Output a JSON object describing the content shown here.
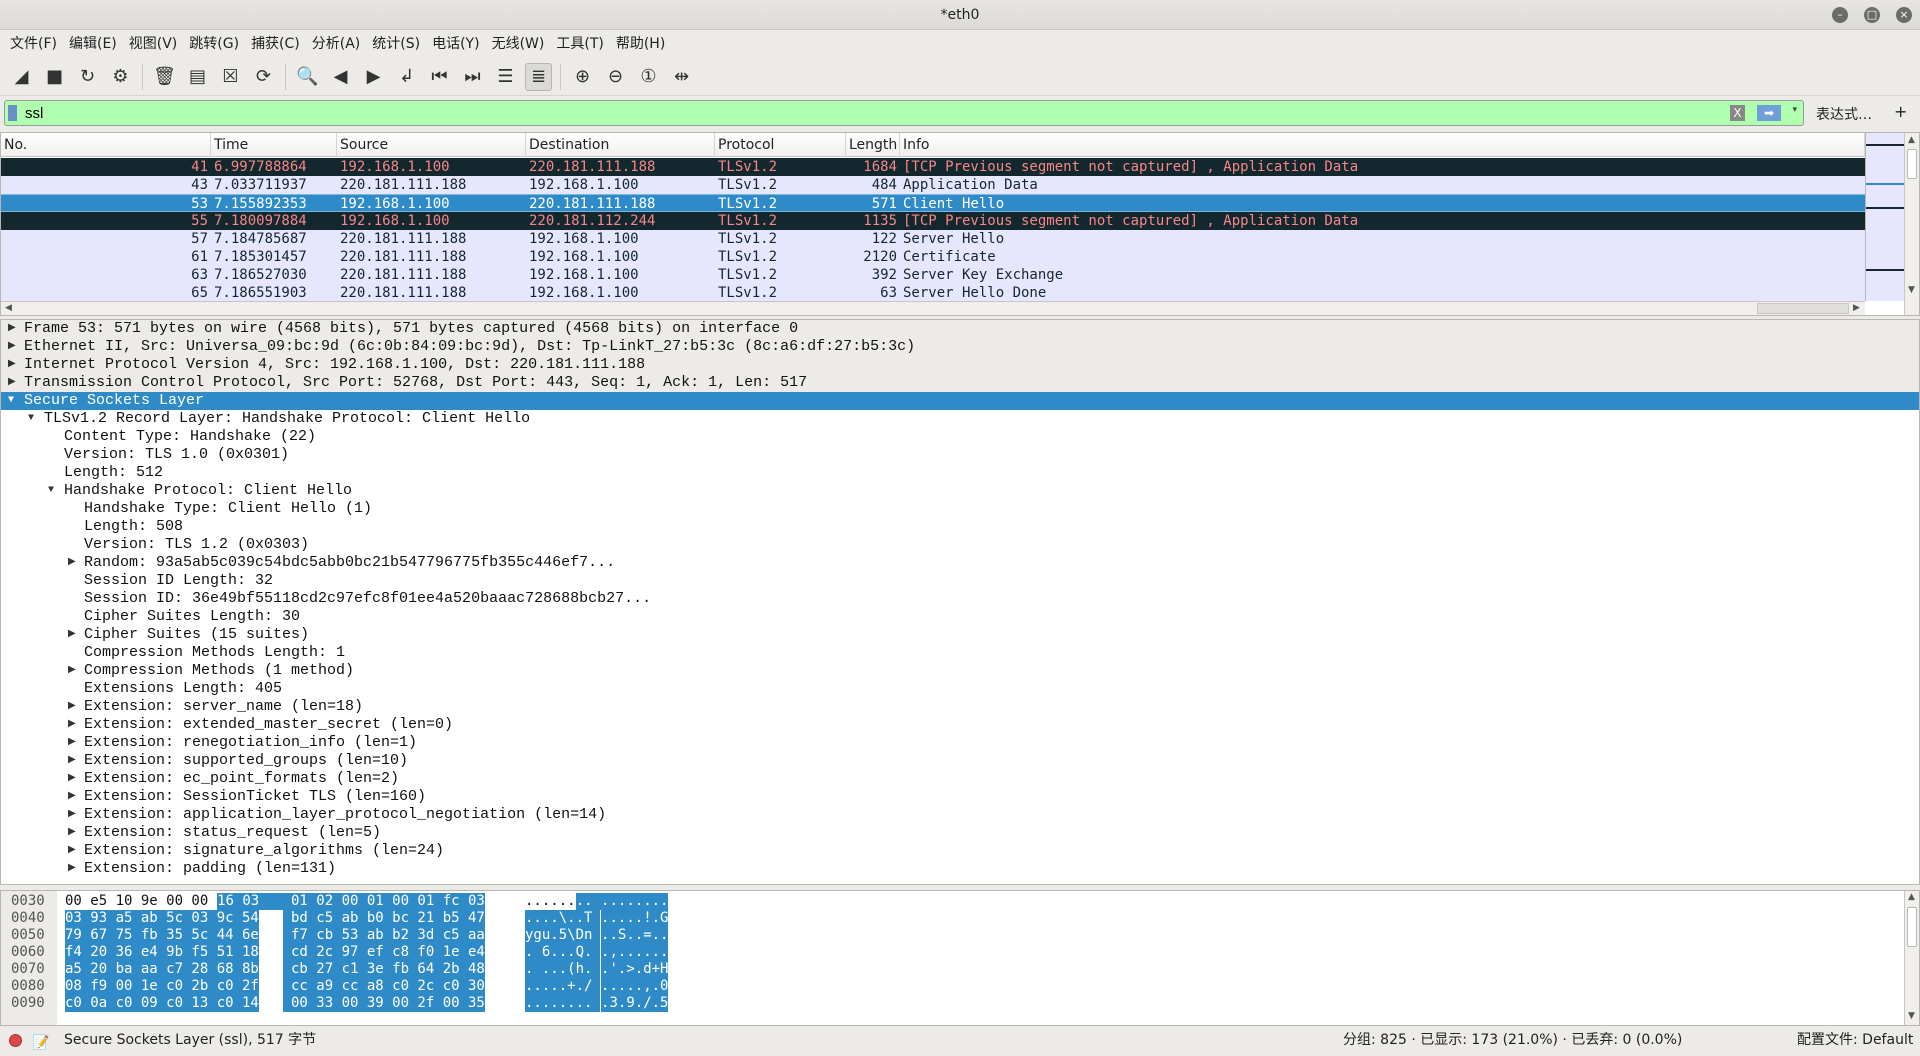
{
  "window": {
    "title": "*eth0",
    "controls": [
      "minimize",
      "maximize",
      "close"
    ]
  },
  "menu": [
    "文件(F)",
    "编辑(E)",
    "视图(V)",
    "跳转(G)",
    "捕获(C)",
    "分析(A)",
    "统计(S)",
    "电话(Y)",
    "无线(W)",
    "工具(T)",
    "帮助(H)"
  ],
  "toolbar": [
    {
      "icon": "shark-fin-start-icon",
      "glyph": "◢"
    },
    {
      "icon": "stop-icon",
      "glyph": "■"
    },
    {
      "icon": "restart-icon",
      "glyph": "↻"
    },
    {
      "icon": "capture-options-gear-icon",
      "glyph": "⚙"
    },
    {
      "sep": true
    },
    {
      "icon": "open-file-icon",
      "glyph": "🗑"
    },
    {
      "icon": "save-file-icon",
      "glyph": "▤"
    },
    {
      "icon": "close-file-icon",
      "glyph": "☒"
    },
    {
      "icon": "reload-file-icon",
      "glyph": "⟳"
    },
    {
      "sep": true
    },
    {
      "icon": "find-packet-icon",
      "glyph": "🔍"
    },
    {
      "icon": "go-back-icon",
      "glyph": "◀"
    },
    {
      "icon": "go-forward-icon",
      "glyph": "▶"
    },
    {
      "icon": "go-to-packet-icon",
      "glyph": "↲"
    },
    {
      "icon": "first-packet-icon",
      "glyph": "⏮"
    },
    {
      "icon": "last-packet-icon",
      "glyph": "⏭"
    },
    {
      "icon": "auto-scroll-icon",
      "glyph": "☰"
    },
    {
      "icon": "colorize-icon",
      "glyph": "≣",
      "active": true
    },
    {
      "sep": true
    },
    {
      "icon": "zoom-in-icon",
      "glyph": "⊕"
    },
    {
      "icon": "zoom-out-icon",
      "glyph": "⊖"
    },
    {
      "icon": "normal-size-icon",
      "glyph": "①"
    },
    {
      "icon": "resize-columns-icon",
      "glyph": "⇹"
    }
  ],
  "filter": {
    "value": "ssl",
    "color": "#afffaf",
    "expression_label": "表达式…",
    "add_label": "+",
    "clear_glyph": "X",
    "apply_glyph": "➡",
    "dropdown_glyph": "▾"
  },
  "packet_list": {
    "columns": [
      "No.",
      "Time",
      "Source",
      "Destination",
      "Protocol",
      "Length",
      "Info"
    ],
    "rows": [
      {
        "no": "41",
        "time": "6.997788864",
        "src": "192.168.1.100",
        "dst": "220.181.111.188",
        "proto": "TLSv1.2",
        "len": "1684",
        "info": "[TCP Previous segment not captured] , Application Data",
        "style": "dark"
      },
      {
        "no": "43",
        "time": "7.033711937",
        "src": "220.181.111.188",
        "dst": "192.168.1.100",
        "proto": "TLSv1.2",
        "len": "484",
        "info": "Application Data",
        "style": "normal"
      },
      {
        "no": "53",
        "time": "7.155892353",
        "src": "192.168.1.100",
        "dst": "220.181.111.188",
        "proto": "TLSv1.2",
        "len": "571",
        "info": "Client Hello",
        "style": "selected"
      },
      {
        "no": "55",
        "time": "7.180097884",
        "src": "192.168.1.100",
        "dst": "220.181.112.244",
        "proto": "TLSv1.2",
        "len": "1135",
        "info": "[TCP Previous segment not captured] , Application Data",
        "style": "dark"
      },
      {
        "no": "57",
        "time": "7.184785687",
        "src": "220.181.111.188",
        "dst": "192.168.1.100",
        "proto": "TLSv1.2",
        "len": "122",
        "info": "Server Hello",
        "style": "normal"
      },
      {
        "no": "61",
        "time": "7.185301457",
        "src": "220.181.111.188",
        "dst": "192.168.1.100",
        "proto": "TLSv1.2",
        "len": "2120",
        "info": "Certificate",
        "style": "normal"
      },
      {
        "no": "63",
        "time": "7.186527030",
        "src": "220.181.111.188",
        "dst": "192.168.1.100",
        "proto": "TLSv1.2",
        "len": "392",
        "info": "Server Key Exchange",
        "style": "normal"
      },
      {
        "no": "65",
        "time": "7.186551903",
        "src": "220.181.111.188",
        "dst": "192.168.1.100",
        "proto": "TLSv1.2",
        "len": "63",
        "info": "Server Hello Done",
        "style": "normal"
      }
    ],
    "colors": {
      "dark_bg": "#12272e",
      "dark_fg": "#f78787",
      "normal_bg": "#e7e6ff",
      "selected_bg": "#2f8bc8"
    }
  },
  "details": [
    {
      "level": 0,
      "arrow": "right",
      "text": "Frame 53: 571 bytes on wire (4568 bits), 571 bytes captured (4568 bits) on interface 0"
    },
    {
      "level": 0,
      "arrow": "right",
      "text": "Ethernet II, Src: Universa_09:bc:9d (6c:0b:84:09:bc:9d), Dst: Tp-LinkT_27:b5:3c (8c:a6:df:27:b5:3c)"
    },
    {
      "level": 0,
      "arrow": "right",
      "text": "Internet Protocol Version 4, Src: 192.168.1.100, Dst: 220.181.111.188"
    },
    {
      "level": 0,
      "arrow": "right",
      "text": "Transmission Control Protocol, Src Port: 52768, Dst Port: 443, Seq: 1, Ack: 1, Len: 517"
    },
    {
      "level": 0,
      "arrow": "down",
      "text": "Secure Sockets Layer",
      "selected": true
    },
    {
      "level": 1,
      "arrow": "down",
      "text": "TLSv1.2 Record Layer: Handshake Protocol: Client Hello"
    },
    {
      "level": 2,
      "text": "Content Type: Handshake (22)"
    },
    {
      "level": 2,
      "text": "Version: TLS 1.0 (0x0301)"
    },
    {
      "level": 2,
      "text": "Length: 512"
    },
    {
      "level": 2,
      "arrow": "down",
      "text": "Handshake Protocol: Client Hello"
    },
    {
      "level": 3,
      "text": "Handshake Type: Client Hello (1)"
    },
    {
      "level": 3,
      "text": "Length: 508"
    },
    {
      "level": 3,
      "text": "Version: TLS 1.2 (0x0303)"
    },
    {
      "level": 3,
      "arrow": "right",
      "text": "Random: 93a5ab5c039c54bdc5abb0bc21b547796775fb355c446ef7..."
    },
    {
      "level": 3,
      "text": "Session ID Length: 32"
    },
    {
      "level": 3,
      "text": "Session ID: 36e49bf55118cd2c97efc8f01ee4a520baaac728688bcb27..."
    },
    {
      "level": 3,
      "text": "Cipher Suites Length: 30"
    },
    {
      "level": 3,
      "arrow": "right",
      "text": "Cipher Suites (15 suites)"
    },
    {
      "level": 3,
      "text": "Compression Methods Length: 1"
    },
    {
      "level": 3,
      "arrow": "right",
      "text": "Compression Methods (1 method)"
    },
    {
      "level": 3,
      "text": "Extensions Length: 405"
    },
    {
      "level": 3,
      "arrow": "right",
      "text": "Extension: server_name (len=18)"
    },
    {
      "level": 3,
      "arrow": "right",
      "text": "Extension: extended_master_secret (len=0)"
    },
    {
      "level": 3,
      "arrow": "right",
      "text": "Extension: renegotiation_info (len=1)"
    },
    {
      "level": 3,
      "arrow": "right",
      "text": "Extension: supported_groups (len=10)"
    },
    {
      "level": 3,
      "arrow": "right",
      "text": "Extension: ec_point_formats (len=2)"
    },
    {
      "level": 3,
      "arrow": "right",
      "text": "Extension: SessionTicket TLS (len=160)"
    },
    {
      "level": 3,
      "arrow": "right",
      "text": "Extension: application_layer_protocol_negotiation (len=14)"
    },
    {
      "level": 3,
      "arrow": "right",
      "text": "Extension: status_request (len=5)"
    },
    {
      "level": 3,
      "arrow": "right",
      "text": "Extension: signature_algorithms (len=24)"
    },
    {
      "level": 3,
      "arrow": "right",
      "text": "Extension: padding (len=131)"
    }
  ],
  "hex": [
    {
      "offset": "0030",
      "plain_hex": "00 e5 10 9e 00 00 ",
      "hex1": "16 03",
      "hex2": "01 02 00 01 00 01 fc 03",
      "plain_ascii": "......",
      "ascii1": "..",
      "ascii2": "........"
    },
    {
      "offset": "0040",
      "hex1": "03 93 a5 ab 5c 03 9c 54",
      "hex2": "bd c5 ab b0 bc 21 b5 47",
      "ascii1": "....\\..T",
      "ascii2": ".....!.G"
    },
    {
      "offset": "0050",
      "hex1": "79 67 75 fb 35 5c 44 6e",
      "hex2": "f7 cb 53 ab b2 3d c5 aa",
      "ascii1": "ygu.5\\Dn",
      "ascii2": "..S..=.."
    },
    {
      "offset": "0060",
      "hex1": "f4 20 36 e4 9b f5 51 18",
      "hex2": "cd 2c 97 ef c8 f0 1e e4",
      "ascii1": ". 6...Q.",
      "ascii2": ".,......"
    },
    {
      "offset": "0070",
      "hex1": "a5 20 ba aa c7 28 68 8b",
      "hex2": "cb 27 c1 3e fb 64 2b 48",
      "ascii1": ". ...(h.",
      "ascii2": ".'.>.d+H"
    },
    {
      "offset": "0080",
      "hex1": "08 f9 00 1e c0 2b c0 2f",
      "hex2": "cc a9 cc a8 c0 2c c0 30",
      "ascii1": ".....+./",
      "ascii2": ".....,.0"
    },
    {
      "offset": "0090",
      "hex1": "c0 0a c0 09 c0 13 c0 14",
      "hex2": "00 33 00 39 00 2f 00 35",
      "ascii1": "........",
      "ascii2": ".3.9./.5"
    }
  ],
  "status": {
    "field": "Secure Sockets Layer (ssl), 517 字节",
    "counts": "分组: 825 · 已显示: 173 (21.0%) · 已丢弃: 0 (0.0%)",
    "profile": "配置文件: Default"
  }
}
